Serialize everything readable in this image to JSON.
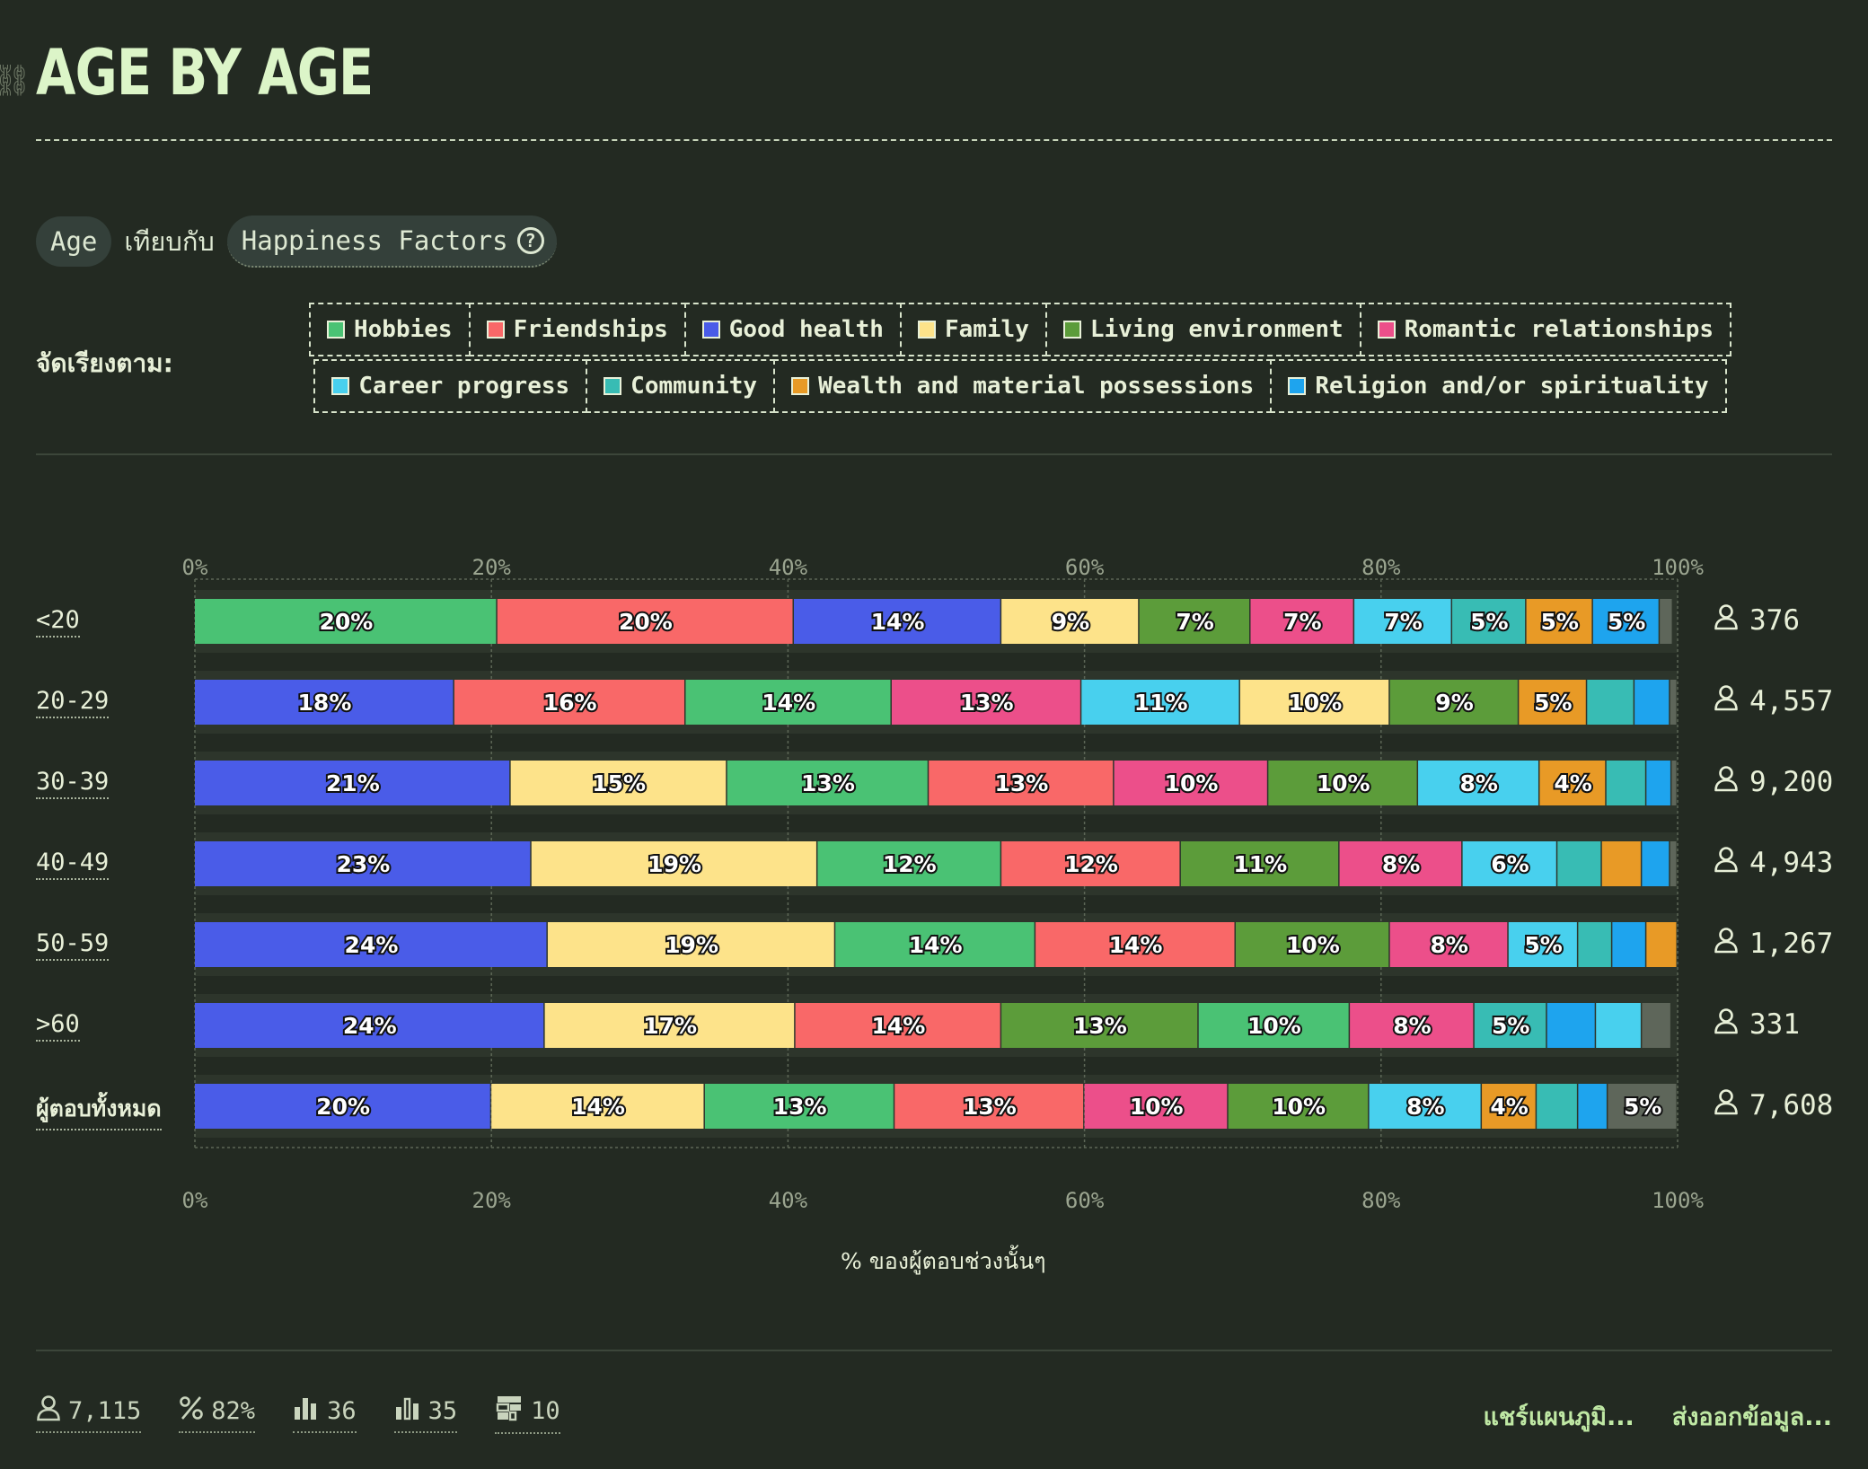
{
  "header": {
    "title": "AGE BY AGE"
  },
  "compare": {
    "left": "Age",
    "vs": "เทียบกับ",
    "right": "Happiness Factors",
    "help": "?"
  },
  "sort": {
    "label": "จัดเรียงตาม:"
  },
  "colors": {
    "Hobbies": "#4ac274",
    "Friendships": "#f96868",
    "Good health": "#4a5ce8",
    "Family": "#fde38a",
    "Living environment": "#5c9c3a",
    "Romantic relationships": "#ec4f8a",
    "Career progress": "#48d0ee",
    "Community": "#38bcb4",
    "Wealth and material possessions": "#e89a26",
    "Religion and/or spirituality": "#1ea4ee",
    "Other": "#5e665a",
    "track": "#2d352b"
  },
  "chart_data": {
    "type": "bar",
    "orientation": "horizontal",
    "stacked": true,
    "xlim": [
      0,
      100
    ],
    "xticks": [
      "0%",
      "20%",
      "40%",
      "60%",
      "80%",
      "100%"
    ],
    "xlabel": "% ของผู้ตอบช่วงนั้นๆ",
    "legend": [
      "Hobbies",
      "Friendships",
      "Good health",
      "Family",
      "Living environment",
      "Romantic relationships",
      "Career progress",
      "Community",
      "Wealth and material possessions",
      "Religion and/or spirituality"
    ],
    "legend_placement": "top",
    "rows": [
      {
        "label": "<20",
        "count": "376",
        "segments": [
          {
            "factor": "Hobbies",
            "value": 20.4,
            "label": "20%"
          },
          {
            "factor": "Friendships",
            "value": 20,
            "label": "20%"
          },
          {
            "factor": "Good health",
            "value": 14,
            "label": "14%"
          },
          {
            "factor": "Family",
            "value": 9.3,
            "label": "9%"
          },
          {
            "factor": "Living environment",
            "value": 7.5,
            "label": "7%"
          },
          {
            "factor": "Romantic relationships",
            "value": 7,
            "label": "7%"
          },
          {
            "factor": "Career progress",
            "value": 6.6,
            "label": "7%"
          },
          {
            "factor": "Community",
            "value": 5,
            "label": "5%"
          },
          {
            "factor": "Wealth and material possessions",
            "value": 4.5,
            "label": "5%"
          },
          {
            "factor": "Religion and/or spirituality",
            "value": 4.5,
            "label": "5%"
          },
          {
            "factor": "Other",
            "value": 0.9,
            "label": ""
          }
        ]
      },
      {
        "label": "20-29",
        "count": "4,557",
        "segments": [
          {
            "factor": "Good health",
            "value": 17.5,
            "label": "18%"
          },
          {
            "factor": "Friendships",
            "value": 15.6,
            "label": "16%"
          },
          {
            "factor": "Hobbies",
            "value": 13.9,
            "label": "14%"
          },
          {
            "factor": "Romantic relationships",
            "value": 12.8,
            "label": "13%"
          },
          {
            "factor": "Career progress",
            "value": 10.7,
            "label": "11%"
          },
          {
            "factor": "Family",
            "value": 10.1,
            "label": "10%"
          },
          {
            "factor": "Living environment",
            "value": 8.7,
            "label": "9%"
          },
          {
            "factor": "Wealth and material possessions",
            "value": 4.6,
            "label": "5%"
          },
          {
            "factor": "Community",
            "value": 3.2,
            "label": ""
          },
          {
            "factor": "Religion and/or spirituality",
            "value": 2.4,
            "label": ""
          },
          {
            "factor": "Other",
            "value": 0.5,
            "label": ""
          }
        ]
      },
      {
        "label": "30-39",
        "count": "9,200",
        "segments": [
          {
            "factor": "Good health",
            "value": 21.3,
            "label": "21%"
          },
          {
            "factor": "Family",
            "value": 14.6,
            "label": "15%"
          },
          {
            "factor": "Hobbies",
            "value": 13.6,
            "label": "13%"
          },
          {
            "factor": "Friendships",
            "value": 12.5,
            "label": "13%"
          },
          {
            "factor": "Romantic relationships",
            "value": 10.4,
            "label": "10%"
          },
          {
            "factor": "Living environment",
            "value": 10.1,
            "label": "10%"
          },
          {
            "factor": "Career progress",
            "value": 8.2,
            "label": "8%"
          },
          {
            "factor": "Wealth and material possessions",
            "value": 4.5,
            "label": "4%"
          },
          {
            "factor": "Community",
            "value": 2.7,
            "label": ""
          },
          {
            "factor": "Religion and/or spirituality",
            "value": 1.7,
            "label": ""
          },
          {
            "factor": "Other",
            "value": 0.4,
            "label": ""
          }
        ]
      },
      {
        "label": "40-49",
        "count": "4,943",
        "segments": [
          {
            "factor": "Good health",
            "value": 22.7,
            "label": "23%"
          },
          {
            "factor": "Family",
            "value": 19.3,
            "label": "19%"
          },
          {
            "factor": "Hobbies",
            "value": 12.4,
            "label": "12%"
          },
          {
            "factor": "Friendships",
            "value": 12.1,
            "label": "12%"
          },
          {
            "factor": "Living environment",
            "value": 10.7,
            "label": "11%"
          },
          {
            "factor": "Romantic relationships",
            "value": 8.3,
            "label": "8%"
          },
          {
            "factor": "Career progress",
            "value": 6.4,
            "label": "6%"
          },
          {
            "factor": "Community",
            "value": 3,
            "label": ""
          },
          {
            "factor": "Wealth and material possessions",
            "value": 2.7,
            "label": ""
          },
          {
            "factor": "Religion and/or spirituality",
            "value": 1.9,
            "label": ""
          },
          {
            "factor": "Other",
            "value": 0.5,
            "label": ""
          }
        ]
      },
      {
        "label": "50-59",
        "count": "1,267",
        "segments": [
          {
            "factor": "Good health",
            "value": 23.8,
            "label": "24%"
          },
          {
            "factor": "Family",
            "value": 19.4,
            "label": "19%"
          },
          {
            "factor": "Hobbies",
            "value": 13.5,
            "label": "14%"
          },
          {
            "factor": "Friendships",
            "value": 13.5,
            "label": "14%"
          },
          {
            "factor": "Living environment",
            "value": 10.4,
            "label": "10%"
          },
          {
            "factor": "Romantic relationships",
            "value": 8,
            "label": "8%"
          },
          {
            "factor": "Career progress",
            "value": 4.7,
            "label": "5%"
          },
          {
            "factor": "Community",
            "value": 2.3,
            "label": ""
          },
          {
            "factor": "Religion and/or spirituality",
            "value": 2.3,
            "label": ""
          },
          {
            "factor": "Wealth and material possessions",
            "value": 2.1,
            "label": ""
          }
        ]
      },
      {
        "label": ">60",
        "count": "331",
        "segments": [
          {
            "factor": "Good health",
            "value": 23.6,
            "label": "24%"
          },
          {
            "factor": "Family",
            "value": 16.9,
            "label": "17%"
          },
          {
            "factor": "Friendships",
            "value": 13.9,
            "label": "14%"
          },
          {
            "factor": "Living environment",
            "value": 13.3,
            "label": "13%"
          },
          {
            "factor": "Hobbies",
            "value": 10.2,
            "label": "10%"
          },
          {
            "factor": "Romantic relationships",
            "value": 8.4,
            "label": "8%"
          },
          {
            "factor": "Community",
            "value": 4.9,
            "label": "5%"
          },
          {
            "factor": "Religion and/or spirituality",
            "value": 3.3,
            "label": ""
          },
          {
            "factor": "Career progress",
            "value": 3.1,
            "label": ""
          },
          {
            "factor": "Other",
            "value": 2,
            "label": ""
          }
        ]
      },
      {
        "label": "ผู้ตอบทั้งหมด",
        "count": "7,608",
        "segments": [
          {
            "factor": "Good health",
            "value": 20,
            "label": "20%"
          },
          {
            "factor": "Family",
            "value": 14.4,
            "label": "14%"
          },
          {
            "factor": "Hobbies",
            "value": 12.8,
            "label": "13%"
          },
          {
            "factor": "Friendships",
            "value": 12.8,
            "label": "13%"
          },
          {
            "factor": "Romantic relationships",
            "value": 9.7,
            "label": "10%"
          },
          {
            "factor": "Living environment",
            "value": 9.5,
            "label": "10%"
          },
          {
            "factor": "Career progress",
            "value": 7.6,
            "label": "8%"
          },
          {
            "factor": "Wealth and material possessions",
            "value": 3.7,
            "label": "4%"
          },
          {
            "factor": "Community",
            "value": 2.8,
            "label": ""
          },
          {
            "factor": "Religion and/or spirituality",
            "value": 2,
            "label": ""
          },
          {
            "factor": "Other",
            "value": 4.7,
            "label": "5%"
          }
        ]
      }
    ]
  },
  "footer": {
    "stats": [
      {
        "icon": "person-icon",
        "value": "7,115"
      },
      {
        "icon": "percent-icon",
        "value": "82%"
      },
      {
        "icon": "bar-chart-icon",
        "value": "36"
      },
      {
        "icon": "bar-chart-outline-icon",
        "value": "35"
      },
      {
        "icon": "table-icon",
        "value": "10"
      }
    ],
    "share": "แชร์แผนภูมิ...",
    "export": "ส่งออกข้อมูล..."
  }
}
